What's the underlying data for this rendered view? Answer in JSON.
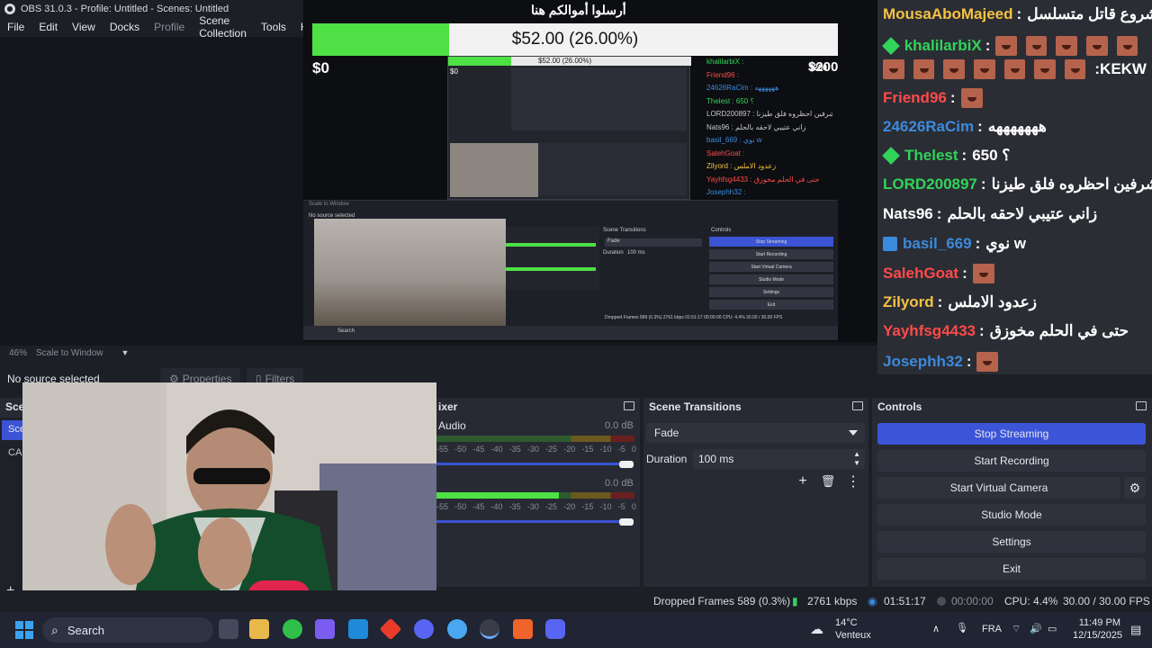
{
  "window": {
    "title": "OBS 31.0.3 - Profile: Untitled - Scenes: Untitled"
  },
  "menu": {
    "file": "File",
    "edit": "Edit",
    "view": "View",
    "docks": "Docks",
    "profile": "Profile",
    "scene_collection": "Scene Collection",
    "tools": "Tools",
    "help": "He"
  },
  "preview": {
    "donation_heading": "أرسلوا أموالكم هنا",
    "goal_text": "$52.00 (26.00%)",
    "goal_fraction": 0.26,
    "goal_min": "$0",
    "goal_max": "$200",
    "zoom": "46%",
    "scale_mode": "Scale to Window"
  },
  "chat": [
    {
      "user": "MousaAboMajeed",
      "color": "#f5c242",
      "msg": "مشروع قاتل متسلسل"
    },
    {
      "user": "khalilarbiX",
      "color": "#31d35a",
      "badge": "diamond-green",
      "msg": "",
      "emotes": 5
    },
    {
      "user": "",
      "color": "#ffffff",
      "msg": ":KEKW",
      "emotes": 7
    },
    {
      "user": "Friend96",
      "color": "#ff4a4a",
      "msg": "",
      "emotes": 1
    },
    {
      "user": "24626RaCim",
      "color": "#3b8bdc",
      "msg": "هههههههه"
    },
    {
      "user": "Thelest",
      "color": "#31d35a",
      "badge": "diamond-green",
      "msg": "650 ؟"
    },
    {
      "user": "LORD200897",
      "color": "#31d35a",
      "msg": "يامشرفين احظروه فلق طيزنا"
    },
    {
      "user": "Nats96",
      "color": "#ffffff",
      "msg": "زاني عتيبي لاحقه بالحلم"
    },
    {
      "user": "basil_669",
      "color": "#3b8bdc",
      "badge": "square-blue",
      "msg": "نوي w"
    },
    {
      "user": "SalehGoat",
      "color": "#ff4a4a",
      "msg": "",
      "emotes": 1
    },
    {
      "user": "Zilyord",
      "color": "#f5c242",
      "msg": "زعدود الاملس"
    },
    {
      "user": "Yayhfsg4433",
      "color": "#ff4a4a",
      "msg": "حتى في الحلم مخوزق"
    },
    {
      "user": "Josephh32",
      "color": "#3b8bdc",
      "msg": "",
      "emotes": 1
    }
  ],
  "sources": {
    "no_source": "No source selected",
    "properties": "Properties",
    "filters": "Filters"
  },
  "docks": {
    "scenes_title": "Sce",
    "scene_items": [
      "Sce",
      "CAI"
    ],
    "mixer_title": "ixer",
    "mixer_track1": "Audio",
    "mixer_track1_db": "0.0 dB",
    "mixer_track2_db": "0.0 dB",
    "scale": [
      "-55",
      "-50",
      "-45",
      "-40",
      "-35",
      "-30",
      "-25",
      "-20",
      "-15",
      "-10",
      "-5",
      "0"
    ],
    "transitions_title": "Scene Transitions",
    "transition": "Fade",
    "duration_label": "Duration",
    "duration_value": "100 ms",
    "controls_title": "Controls",
    "stop_streaming": "Stop Streaming",
    "start_recording": "Start Recording",
    "start_virtual_camera": "Start Virtual Camera",
    "studio_mode": "Studio Mode",
    "settings": "Settings",
    "exit": "Exit"
  },
  "status": {
    "dropped": "Dropped Frames 589 (0.3%)",
    "bitrate": "2761 kbps",
    "stream_time": "01:51:17",
    "rec_time": "00:00:00",
    "cpu": "CPU: 4.4%",
    "fps": "30.00 / 30.00 FPS"
  },
  "taskbar": {
    "search": "Search",
    "weather_temp": "14°C",
    "weather_desc": "Venteux",
    "lang": "FRA",
    "time": "11:49 PM",
    "date": "12/15/2025"
  },
  "nested_preview": {
    "goal_text": "$52.00 (26.00%)",
    "goal_min": "$0",
    "goal_max": "$200",
    "chat": [
      "khalilarbiX :",
      "Friend96 :",
      "24626RaCim : ههههههه",
      "Thelest : 650 ؟",
      "LORD200897 : يامشرفين احظروه فلق طيزنا",
      "Nats96 : زاني عتيبي لاحقه بالحلم",
      "basil_669 : نوي w",
      "SalehGoat :",
      "Zilyord : زعدود الاملس",
      "Yayhfsg4433 : حتى في الحلم مخوزق",
      "Josephh32 :"
    ],
    "no_source": "No source selected",
    "scale": "Scale to Window",
    "transitions": "Scene Transitions",
    "controls": "Controls",
    "fade": "Fade",
    "duration": "Duration",
    "duration_value": "100 ms",
    "buttons": [
      "Stop Streaming",
      "Start Recording",
      "Start Virtual Camera",
      "Studio Mode",
      "Settings",
      "Exit"
    ],
    "status": "Dropped Frames 589 (0.3%)   2761 kbps   01:51:17   00:00:00   CPU: 4.4%   30.00 / 30.00 FPS",
    "search": "Search"
  }
}
